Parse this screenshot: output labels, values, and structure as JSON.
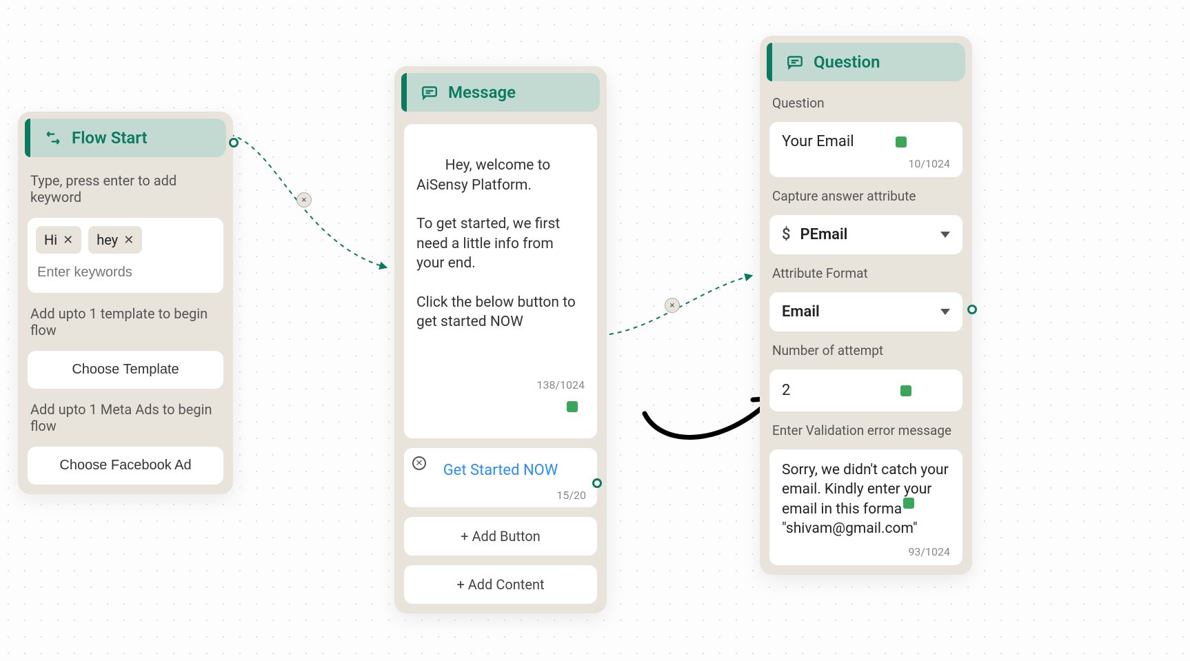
{
  "flowStart": {
    "title": "Flow Start",
    "keywordHint": "Type, press enter to add keyword",
    "chips": [
      "Hi",
      "hey"
    ],
    "keywordPlaceholder": "Enter keywords",
    "templateHint": "Add upto 1 template to begin flow",
    "templateBtn": "Choose Template",
    "metaHint": "Add upto 1 Meta Ads to begin flow",
    "metaBtn": "Choose Facebook Ad"
  },
  "message": {
    "title": "Message",
    "body": "Hey, welcome to AiSensy Platform.\n\nTo get started, we first need a little info from your end.\n\nClick the below button to get started NOW",
    "bodyCounter": "138/1024",
    "button": {
      "label": "Get Started NOW",
      "counter": "15/20"
    },
    "addButton": "+ Add Button",
    "addContent": "+ Add Content"
  },
  "question": {
    "title": "Question",
    "questionLabel": "Question",
    "questionValue": "Your Email",
    "questionCounter": "10/1024",
    "captureLabel": "Capture answer attribute",
    "captureValue": "PEmail",
    "formatLabel": "Attribute Format",
    "formatValue": "Email",
    "attemptLabel": "Number of attempt",
    "attemptValue": "2",
    "errorLabel": "Enter Validation error message",
    "errorValue": "Sorry, we didn't catch your email. Kindly enter your email in this forma    \"shivam@gmail.com\"",
    "errorCounter": "93/1024"
  }
}
